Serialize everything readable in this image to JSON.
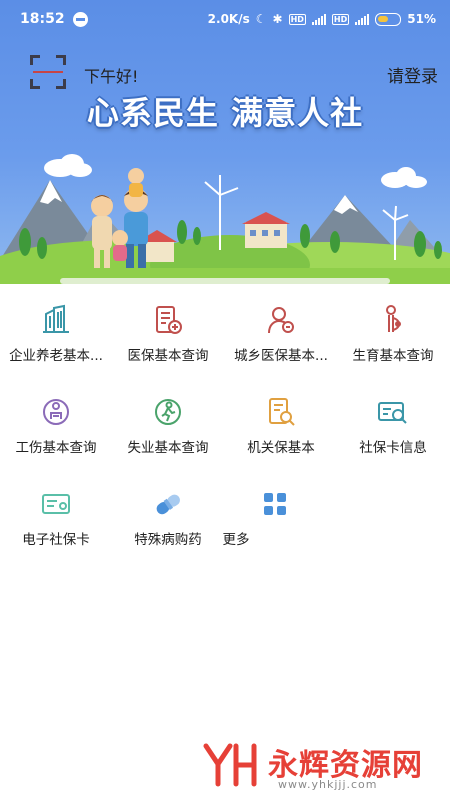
{
  "status_bar": {
    "time": "18:52",
    "network_speed": "2.0K/s",
    "battery_percent": "51%",
    "battery_level": 0.51
  },
  "header": {
    "greeting": "下午好!",
    "login_label": "请登录",
    "slogan": "心系民生  满意人社"
  },
  "services": [
    {
      "label": "企业养老基本...",
      "icon": "building-icon",
      "color": "#3a96a8"
    },
    {
      "label": "医保基本查询",
      "icon": "medical-card-icon",
      "color": "#c0504d"
    },
    {
      "label": "城乡医保基本...",
      "icon": "person-icon",
      "color": "#c0504d"
    },
    {
      "label": "生育基本查询",
      "icon": "pregnant-icon",
      "color": "#c0504d"
    },
    {
      "label": "工伤基本查询",
      "icon": "injury-icon",
      "color": "#8b6bb8"
    },
    {
      "label": "失业基本查询",
      "icon": "walking-person-icon",
      "color": "#4aa36b"
    },
    {
      "label": "机关保基本",
      "icon": "document-search-icon",
      "color": "#e0a040"
    },
    {
      "label": "社保卡信息",
      "icon": "card-search-icon",
      "color": "#3a96a8"
    },
    {
      "label": "电子社保卡",
      "icon": "e-card-icon",
      "color": "#5abfa8"
    },
    {
      "label": "特殊病购药",
      "icon": "pill-icon",
      "color": "#4a90d9"
    },
    {
      "label": "更多",
      "icon": "grid-icon",
      "color": "#4a90d9"
    }
  ],
  "watermark": {
    "name": "永辉资源网",
    "url": "www.yhkjjj.com",
    "color": "#e64037"
  }
}
